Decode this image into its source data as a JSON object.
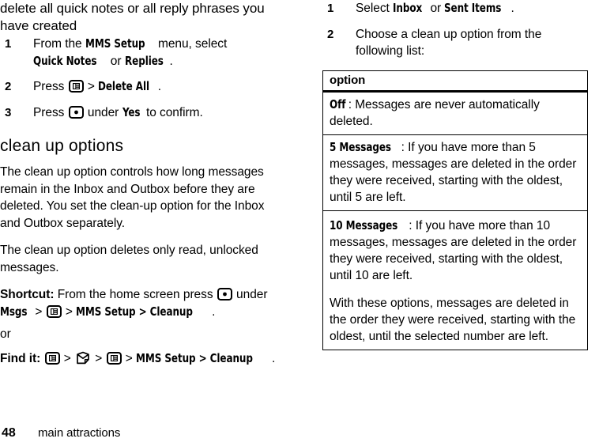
{
  "document": {
    "page_number": "48",
    "footer_title": "main attractions"
  },
  "left_column": {
    "continued_heading": "delete all quick notes or all reply phrases you have created",
    "steps": [
      {
        "num": "1",
        "parts": [
          {
            "t": "From the ",
            "style": "plain"
          },
          {
            "t": "MMS Setup",
            "style": "ui"
          },
          {
            "t": " menu, select ",
            "style": "plain"
          },
          {
            "t": "Quick Notes",
            "style": "ui"
          },
          {
            "t": " or ",
            "style": "plain"
          },
          {
            "t": "Replies",
            "style": "ui"
          },
          {
            "t": ".",
            "style": "plain"
          }
        ]
      },
      {
        "num": "2",
        "parts": [
          {
            "t": "Press ",
            "style": "plain"
          },
          {
            "t": "menu-key-icon",
            "style": "icon"
          },
          {
            "t": " > ",
            "style": "plain"
          },
          {
            "t": "Delete All",
            "style": "ui"
          },
          {
            "t": ".",
            "style": "plain"
          }
        ]
      },
      {
        "num": "3",
        "parts": [
          {
            "t": "Press ",
            "style": "plain"
          },
          {
            "t": "center-select-key-icon",
            "style": "icon"
          },
          {
            "t": " under ",
            "style": "plain"
          },
          {
            "t": "Yes",
            "style": "ui"
          },
          {
            "t": " to confirm.",
            "style": "plain"
          }
        ]
      }
    ],
    "section_heading": "clean up options",
    "paragraph_1": "The clean up option controls how long messages remain in the Inbox and Outbox before they are deleted. You set the clean-up option for the Inbox and Outbox separately.",
    "paragraph_2": "The clean up option deletes only read, unlocked messages.",
    "shortcut": {
      "label": "Shortcut:",
      "parts": [
        {
          "t": " From the home screen press ",
          "style": "plain"
        },
        {
          "t": "center-select-key-icon",
          "style": "icon"
        },
        {
          "t": " under ",
          "style": "plain"
        },
        {
          "t": "Msgs",
          "style": "ui"
        },
        {
          "t": " > ",
          "style": "plain"
        },
        {
          "t": "menu-key-icon",
          "style": "icon"
        },
        {
          "t": " > ",
          "style": "plain"
        },
        {
          "t": "MMS Setup > Cleanup",
          "style": "ui"
        },
        {
          "t": ".",
          "style": "plain"
        }
      ]
    },
    "or_text": "or",
    "find_it": {
      "label": "Find it:",
      "parts": [
        {
          "t": " ",
          "style": "plain"
        },
        {
          "t": "menu-key-icon",
          "style": "icon"
        },
        {
          "t": " > ",
          "style": "plain"
        },
        {
          "t": "messages-envelope-icon",
          "style": "icon"
        },
        {
          "t": " > ",
          "style": "plain"
        },
        {
          "t": "menu-key-icon",
          "style": "icon"
        },
        {
          "t": " > ",
          "style": "plain"
        },
        {
          "t": "MMS Setup > Cleanup",
          "style": "ui"
        },
        {
          "t": ".",
          "style": "plain"
        }
      ]
    }
  },
  "right_column": {
    "steps": [
      {
        "num": "1",
        "parts": [
          {
            "t": "Select ",
            "style": "plain"
          },
          {
            "t": "Inbox",
            "style": "ui"
          },
          {
            "t": " or ",
            "style": "plain"
          },
          {
            "t": "Sent Items",
            "style": "ui"
          },
          {
            "t": ".",
            "style": "plain"
          }
        ]
      },
      {
        "num": "2",
        "parts": [
          {
            "t": "Choose a clean up option from the following list:",
            "style": "plain"
          }
        ]
      }
    ],
    "table": {
      "header": "option",
      "rows": [
        {
          "term": "Off",
          "rest": ": Messages are never automatically deleted.",
          "divider": true
        },
        {
          "term": "5 Messages",
          "rest": ": If you have more than 5 messages, messages are deleted in the order they were received, starting with the oldest, until 5 are left.",
          "divider": true
        },
        {
          "term": "10 Messages",
          "rest": ": If you have more than 10 messages, messages are deleted in the order they were received, starting with the oldest, until 10 are left.",
          "divider": false
        },
        {
          "term": "",
          "rest": "With these options, messages are deleted in the order they were received, starting with the oldest, until the selected number are left.",
          "divider": false
        }
      ]
    }
  },
  "colors": {
    "text": "#000000",
    "background": "#ffffff",
    "rule": "#000000"
  }
}
